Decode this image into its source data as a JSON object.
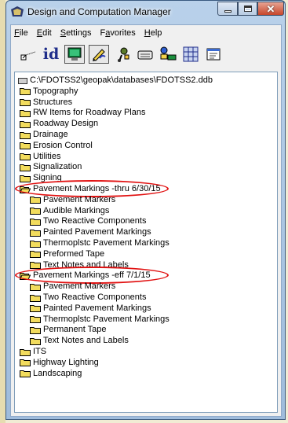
{
  "window": {
    "title": "Design and Computation Manager"
  },
  "menu": [
    {
      "label": "File",
      "key": "F",
      "rest": "ile"
    },
    {
      "label": "Edit",
      "key": "E",
      "rest": "dit"
    },
    {
      "label": "Settings",
      "key": "S",
      "rest": "ettings"
    },
    {
      "label": "Favorites",
      "key": "a",
      "pre": "F",
      "rest": "vorites"
    },
    {
      "label": "Help",
      "key": "H",
      "rest": "elp"
    }
  ],
  "toolbar": {
    "id_label": "id",
    "icons": [
      "spline-icon",
      "id-icon",
      "monitor-icon",
      "pencil-icon",
      "people-icon",
      "keyboard-icon",
      "user-tree-icon",
      "grid-icon",
      "properties-icon"
    ]
  },
  "tree": {
    "root": "C:\\FDOTSS2\\geopak\\databases\\FDOTSS2.ddb",
    "items": [
      {
        "label": "Topography",
        "level": 1
      },
      {
        "label": "Structures",
        "level": 1
      },
      {
        "label": "RW Items for Roadway Plans",
        "level": 1
      },
      {
        "label": "Roadway Design",
        "level": 1
      },
      {
        "label": "Drainage",
        "level": 1
      },
      {
        "label": "Erosion Control",
        "level": 1
      },
      {
        "label": "Utilities",
        "level": 1
      },
      {
        "label": "Signalization",
        "level": 1
      },
      {
        "label": "Signing",
        "level": 1
      },
      {
        "label": "Pavement Markings -thru 6/30/15",
        "level": 1,
        "open": true,
        "highlight": true
      },
      {
        "label": "Pavement Markers",
        "level": 2
      },
      {
        "label": "Audible Markings",
        "level": 2
      },
      {
        "label": "Two Reactive Components",
        "level": 2
      },
      {
        "label": "Painted Pavement Markings",
        "level": 2
      },
      {
        "label": "Thermoplstc Pavement Markings",
        "level": 2
      },
      {
        "label": "Preformed Tape",
        "level": 2
      },
      {
        "label": "Text Notes and Labels",
        "level": 2
      },
      {
        "label": "Pavement Markings -eff 7/1/15",
        "level": 1,
        "open": true,
        "highlight": true
      },
      {
        "label": "Pavement Markers",
        "level": 2
      },
      {
        "label": "Two Reactive Components",
        "level": 2
      },
      {
        "label": "Painted Pavement Markings",
        "level": 2
      },
      {
        "label": "Thermoplstc Pavement Markings",
        "level": 2
      },
      {
        "label": "Permanent Tape",
        "level": 2
      },
      {
        "label": "Text Notes and Labels",
        "level": 2
      },
      {
        "label": "ITS",
        "level": 1
      },
      {
        "label": "Highway Lighting",
        "level": 1
      },
      {
        "label": "Landscaping",
        "level": 1
      }
    ]
  },
  "colors": {
    "folder": "#f2dc5d",
    "folder_outline": "#000000",
    "highlight": "#e11111",
    "title_gradient": "#b9d1ea"
  }
}
